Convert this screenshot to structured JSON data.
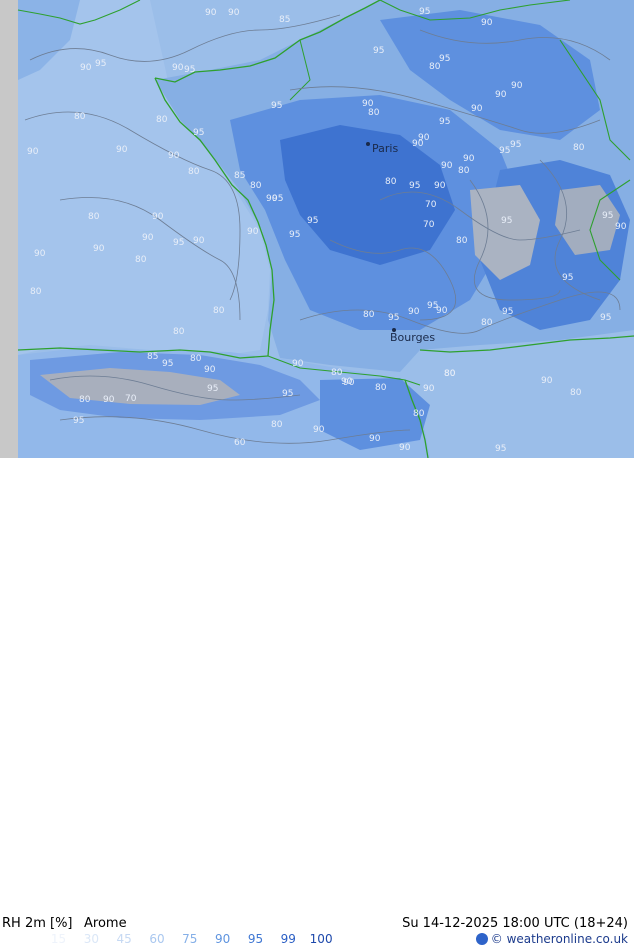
{
  "header": {
    "variable": "RH 2m [%]",
    "model": "Arome",
    "valid_time": "Su 14-12-2025 18:00 UTC (18+24)"
  },
  "legend": {
    "items": [
      {
        "value": "15",
        "color": "#eef3fb"
      },
      {
        "value": "30",
        "color": "#dbe7f7"
      },
      {
        "value": "45",
        "color": "#c6d9f3"
      },
      {
        "value": "60",
        "color": "#a9c7ef"
      },
      {
        "value": "75",
        "color": "#86b0e8"
      },
      {
        "value": "90",
        "color": "#5f94df"
      },
      {
        "value": "95",
        "color": "#3f77d3"
      },
      {
        "value": "99",
        "color": "#2a5ec4"
      },
      {
        "value": "100",
        "color": "#1d48ab"
      }
    ]
  },
  "copyright": "© weatheronline.co.uk",
  "map": {
    "cities": [
      {
        "name": "Paris"
      },
      {
        "name": "Bourges"
      }
    ],
    "colors": {
      "background": "#9bbee9",
      "sea": "#a4c4ec",
      "land": "#86afe4",
      "humid": "#5e90df",
      "very_humid": "#3e73d0",
      "no_data": "#c8c8c8",
      "coast": "#2ea02e",
      "contour": "#6d7d94"
    },
    "contour_labels": [
      "90",
      "90",
      "95",
      "70",
      "80",
      "90",
      "90",
      "80",
      "85",
      "90",
      "80",
      "80",
      "80",
      "80",
      "95",
      "90",
      "90",
      "90",
      "95",
      "90",
      "95",
      "95",
      "90",
      "95",
      "95",
      "90",
      "95",
      "80",
      "80",
      "85",
      "90",
      "95",
      "95",
      "95",
      "95",
      "90",
      "95",
      "90",
      "95",
      "90",
      "90",
      "90",
      "95",
      "80",
      "95",
      "95",
      "80",
      "90",
      "80",
      "90",
      "80",
      "95",
      "80",
      "90",
      "95",
      "95",
      "90",
      "90",
      "80",
      "95",
      "80",
      "90",
      "95",
      "90",
      "70",
      "80",
      "80",
      "90",
      "70",
      "80",
      "85",
      "90",
      "90",
      "95",
      "80",
      "95",
      "95",
      "90",
      "90",
      "80",
      "90",
      "95",
      "80",
      "90",
      "90",
      "80",
      "80",
      "60",
      "80",
      "90",
      "80",
      "90",
      "90",
      "80",
      "90",
      "95",
      "90"
    ]
  }
}
